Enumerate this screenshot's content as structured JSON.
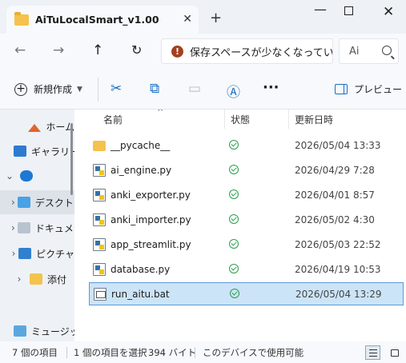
{
  "window": {
    "tab_title": "AiTuLocalSmart_v1.00",
    "close_tab": "✕",
    "new_tab": "+"
  },
  "nav": {
    "address_text": "保存スペースが少なくなっています",
    "search_placeholder": "Ai"
  },
  "toolbar": {
    "new_label": "新規作成",
    "preview_label": "プレビュー"
  },
  "sidebar": {
    "items": [
      {
        "label": "ホーム",
        "icon": "home-icon"
      },
      {
        "label": "ギャラリー",
        "icon": "gallery-icon"
      },
      {
        "label": "",
        "icon": "cloud-icon"
      },
      {
        "label": "デスクトップ",
        "icon": "desktop-icon"
      },
      {
        "label": "ドキュメント",
        "icon": "document-icon"
      },
      {
        "label": "ピクチャ",
        "icon": "pictures-icon"
      },
      {
        "label": "添付",
        "icon": "folder-icon"
      },
      {
        "label": "ミュージック",
        "icon": "drive-icon"
      }
    ]
  },
  "columns": {
    "name": "名前",
    "status": "状態",
    "modified": "更新日時"
  },
  "files": [
    {
      "name": "__pycache__",
      "type": "folder",
      "date": "2026/05/04 13:33"
    },
    {
      "name": "ai_engine.py",
      "type": "py",
      "date": "2026/04/29 7:28"
    },
    {
      "name": "anki_exporter.py",
      "type": "py",
      "date": "2026/04/01 8:57"
    },
    {
      "name": "anki_importer.py",
      "type": "py",
      "date": "2026/05/02 4:30"
    },
    {
      "name": "app_streamlit.py",
      "type": "py",
      "date": "2026/05/03 22:52"
    },
    {
      "name": "database.py",
      "type": "py",
      "date": "2026/04/19 10:53"
    },
    {
      "name": "run_aitu.bat",
      "type": "bat",
      "date": "2026/05/04 13:29",
      "selected": true
    }
  ],
  "status": {
    "item_count": "7 個の項目",
    "selection": "1 個の項目を選択",
    "size": "394 バイト",
    "availability": "このデバイスで使用可能"
  },
  "colors": {
    "accent": "#1b6fc2",
    "selected_row": "#cce4f7",
    "status_ok": "#27a04a"
  }
}
